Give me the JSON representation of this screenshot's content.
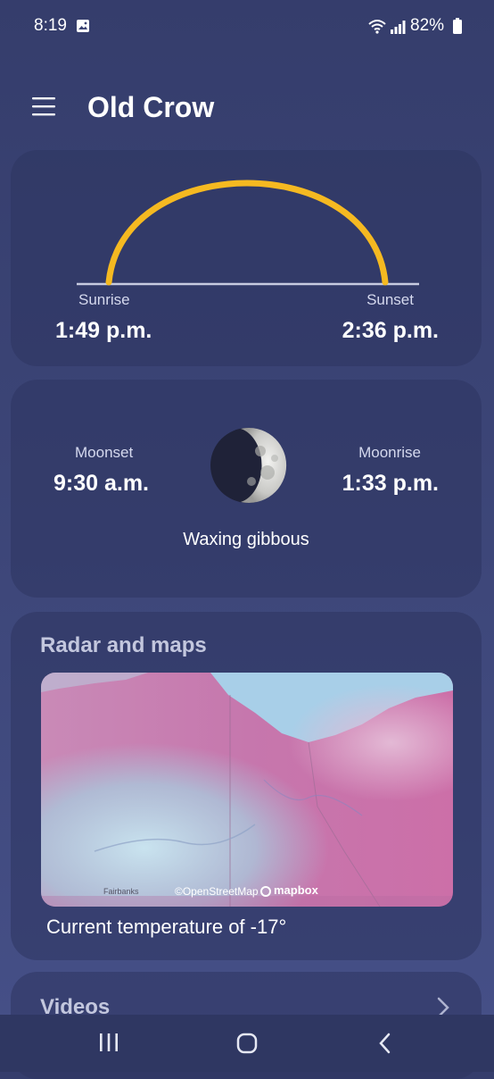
{
  "status_bar": {
    "time": "8:19",
    "battery": "82%"
  },
  "header": {
    "city": "Old Crow"
  },
  "sun": {
    "sunrise_label": "Sunrise",
    "sunrise_time": "1:49 p.m.",
    "sunset_label": "Sunset",
    "sunset_time": "2:36 p.m.",
    "arc_color": "#f5b921"
  },
  "moon": {
    "moonset_label": "Moonset",
    "moonset_time": "9:30 a.m.",
    "moonrise_label": "Moonrise",
    "moonrise_time": "1:33 p.m.",
    "phase": "Waxing gibbous"
  },
  "radar": {
    "title": "Radar and maps",
    "attribution_osm": "©OpenStreetMap",
    "attribution_mapbox": "mapbox",
    "place_label": "Fairbanks",
    "caption": "Current temperature of -17°"
  },
  "videos": {
    "title": "Videos"
  },
  "icons": [
    "gallery-icon",
    "wifi-icon",
    "signal-icon",
    "battery-icon",
    "menu-icon",
    "chevron-right-icon",
    "recents-icon",
    "home-icon",
    "back-icon"
  ]
}
